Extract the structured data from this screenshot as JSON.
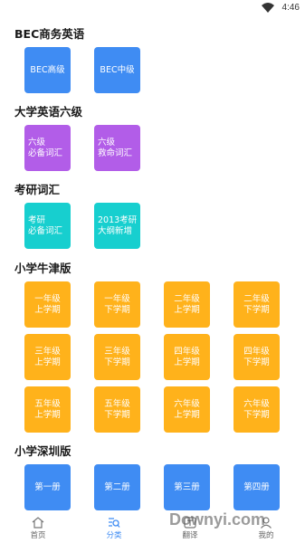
{
  "status": {
    "time": "4:46"
  },
  "sections": [
    {
      "title": "BEC商务英语",
      "items": [
        "BEC高级",
        "BEC中级"
      ]
    },
    {
      "title": "大学英语六级",
      "items": [
        "六级\n必备词汇",
        "六级\n救命词汇"
      ]
    },
    {
      "title": "考研词汇",
      "items": [
        "考研\n必备词汇",
        "2013考研\n大纲新增"
      ]
    },
    {
      "title": "小学牛津版",
      "items": [
        "一年级\n上学期",
        "一年级\n下学期",
        "二年级\n上学期",
        "二年级\n下学期",
        "三年级\n上学期",
        "三年级\n下学期",
        "四年级\n上学期",
        "四年级\n下学期",
        "五年级\n上学期",
        "五年级\n下学期",
        "六年级\n上学期",
        "六年级\n下学期"
      ]
    },
    {
      "title": "小学深圳版",
      "items": [
        "第一册",
        "第二册",
        "第三册",
        "第四册"
      ]
    }
  ],
  "nav": [
    {
      "label": "首页",
      "icon": "home-icon"
    },
    {
      "label": "分类",
      "icon": "category-search-icon"
    },
    {
      "label": "翻译",
      "icon": "translate-icon"
    },
    {
      "label": "我的",
      "icon": "profile-icon"
    }
  ],
  "watermark": "Downyi.com",
  "colors": {
    "blue": "#3f8cf3",
    "purple": "#b25de8",
    "teal": "#17cfcf",
    "orange": "#ffb21b",
    "nav_active": "#3f8cf3"
  }
}
